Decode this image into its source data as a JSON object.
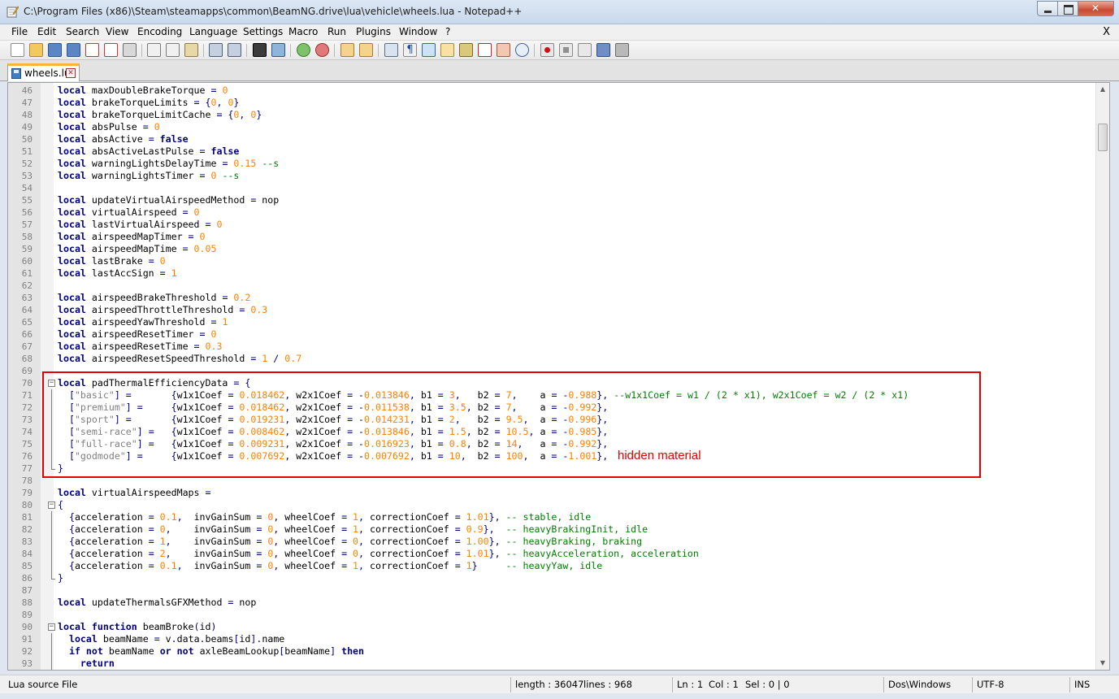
{
  "window": {
    "title": "C:\\Program Files (x86)\\Steam\\steamapps\\common\\BeamNG.drive\\lua\\vehicle\\wheels.lua - Notepad++"
  },
  "menu": {
    "items": [
      "File",
      "Edit",
      "Search",
      "View",
      "Encoding",
      "Language",
      "Settings",
      "Macro",
      "Run",
      "Plugins",
      "Window",
      "?"
    ],
    "close": "X"
  },
  "tab": {
    "label": "wheels.lua"
  },
  "annotation": {
    "text": "hidden material",
    "color": "#e00000"
  },
  "status": {
    "file_type": "Lua source File",
    "length": "length : 36047",
    "lines": "lines : 968",
    "ln": "Ln : 1",
    "col": "Col : 1",
    "sel": "Sel : 0 | 0",
    "eol": "Dos\\Windows",
    "encoding": "UTF-8",
    "mode": "INS"
  },
  "colors": {
    "keyword": "#00007f",
    "number": "#ff8000",
    "string": "#808080",
    "comment": "#008000",
    "tab_accent": "#fab43c"
  },
  "editor": {
    "lines": [
      {
        "n": "46",
        "text": "local maxDoubleBrakeTorque = 0"
      },
      {
        "n": "47",
        "text": "local brakeTorqueLimits = {0, 0}"
      },
      {
        "n": "48",
        "text": "local brakeTorqueLimitCache = {0, 0}"
      },
      {
        "n": "49",
        "text": "local absPulse = 0"
      },
      {
        "n": "50",
        "text": "local absActive = false"
      },
      {
        "n": "51",
        "text": "local absActiveLastPulse = false"
      },
      {
        "n": "52",
        "text": "local warningLightsDelayTime = 0.15 --s"
      },
      {
        "n": "53",
        "text": "local warningLightsTimer = 0 --s"
      },
      {
        "n": "54",
        "text": ""
      },
      {
        "n": "55",
        "text": "local updateVirtualAirspeedMethod = nop"
      },
      {
        "n": "56",
        "text": "local virtualAirspeed = 0"
      },
      {
        "n": "57",
        "text": "local lastVirtualAirspeed = 0"
      },
      {
        "n": "58",
        "text": "local airspeedMapTimer = 0"
      },
      {
        "n": "59",
        "text": "local airspeedMapTime = 0.05"
      },
      {
        "n": "60",
        "text": "local lastBrake = 0"
      },
      {
        "n": "61",
        "text": "local lastAccSign = 1"
      },
      {
        "n": "62",
        "text": ""
      },
      {
        "n": "63",
        "text": "local airspeedBrakeThreshold = 0.2"
      },
      {
        "n": "64",
        "text": "local airspeedThrottleThreshold = 0.3"
      },
      {
        "n": "65",
        "text": "local airspeedYawThreshold = 1"
      },
      {
        "n": "66",
        "text": "local airspeedResetTimer = 0"
      },
      {
        "n": "67",
        "text": "local airspeedResetTime = 0.3"
      },
      {
        "n": "68",
        "text": "local airspeedResetSpeedThreshold = 1 / 0.7"
      },
      {
        "n": "69",
        "text": ""
      },
      {
        "n": "70",
        "text": "local padThermalEfficiencyData = {",
        "fold": "open"
      },
      {
        "n": "71",
        "text": "  [\"basic\"] =       {w1x1Coef = 0.018462, w2x1Coef = -0.013846, b1 = 3,   b2 = 7,    a = -0.988}, --w1x1Coef = w1 / (2 * x1), w2x1Coef = w2 / (2 * x1)",
        "fold": "line"
      },
      {
        "n": "72",
        "text": "  [\"premium\"] =     {w1x1Coef = 0.018462, w2x1Coef = -0.011538, b1 = 3.5, b2 = 7,    a = -0.992},",
        "fold": "line"
      },
      {
        "n": "73",
        "text": "  [\"sport\"] =       {w1x1Coef = 0.019231, w2x1Coef = -0.014231, b1 = 2,   b2 = 9.5,  a = -0.996},",
        "fold": "line"
      },
      {
        "n": "74",
        "text": "  [\"semi-race\"] =   {w1x1Coef = 0.008462, w2x1Coef = -0.013846, b1 = 1.5, b2 = 10.5, a = -0.985},",
        "fold": "line"
      },
      {
        "n": "75",
        "text": "  [\"full-race\"] =   {w1x1Coef = 0.009231, w2x1Coef = -0.016923, b1 = 0.8, b2 = 14,   a = -0.992},",
        "fold": "line"
      },
      {
        "n": "76",
        "text": "  [\"godmode\"] =     {w1x1Coef = 0.007692, w2x1Coef = -0.007692, b1 = 10,  b2 = 100,  a = -1.001},",
        "fold": "line"
      },
      {
        "n": "77",
        "text": "}",
        "fold": "end"
      },
      {
        "n": "78",
        "text": ""
      },
      {
        "n": "79",
        "text": "local virtualAirspeedMaps ="
      },
      {
        "n": "80",
        "text": "{",
        "fold": "open"
      },
      {
        "n": "81",
        "text": "  {acceleration = 0.1,  invGainSum = 0, wheelCoef = 1, correctionCoef = 1.01}, -- stable, idle",
        "fold": "line"
      },
      {
        "n": "82",
        "text": "  {acceleration = 0,    invGainSum = 0, wheelCoef = 1, correctionCoef = 0.9},  -- heavyBrakingInit, idle",
        "fold": "line"
      },
      {
        "n": "83",
        "text": "  {acceleration = 1,    invGainSum = 0, wheelCoef = 0, correctionCoef = 1.00}, -- heavyBraking, braking",
        "fold": "line"
      },
      {
        "n": "84",
        "text": "  {acceleration = 2,    invGainSum = 0, wheelCoef = 0, correctionCoef = 1.01}, -- heavyAcceleration, acceleration",
        "fold": "line"
      },
      {
        "n": "85",
        "text": "  {acceleration = 0.1,  invGainSum = 0, wheelCoef = 1, correctionCoef = 1}     -- heavyYaw, idle",
        "fold": "line"
      },
      {
        "n": "86",
        "text": "}",
        "fold": "end"
      },
      {
        "n": "87",
        "text": ""
      },
      {
        "n": "88",
        "text": "local updateThermalsGFXMethod = nop"
      },
      {
        "n": "89",
        "text": ""
      },
      {
        "n": "90",
        "text": "local function beamBroke(id)",
        "fold": "open"
      },
      {
        "n": "91",
        "text": "  local beamName = v.data.beams[id].name",
        "fold": "line"
      },
      {
        "n": "92",
        "text": "  if not beamName or not axleBeamLookup[beamName] then",
        "fold": "line"
      },
      {
        "n": "93",
        "text": "    return",
        "fold": "line"
      }
    ]
  }
}
